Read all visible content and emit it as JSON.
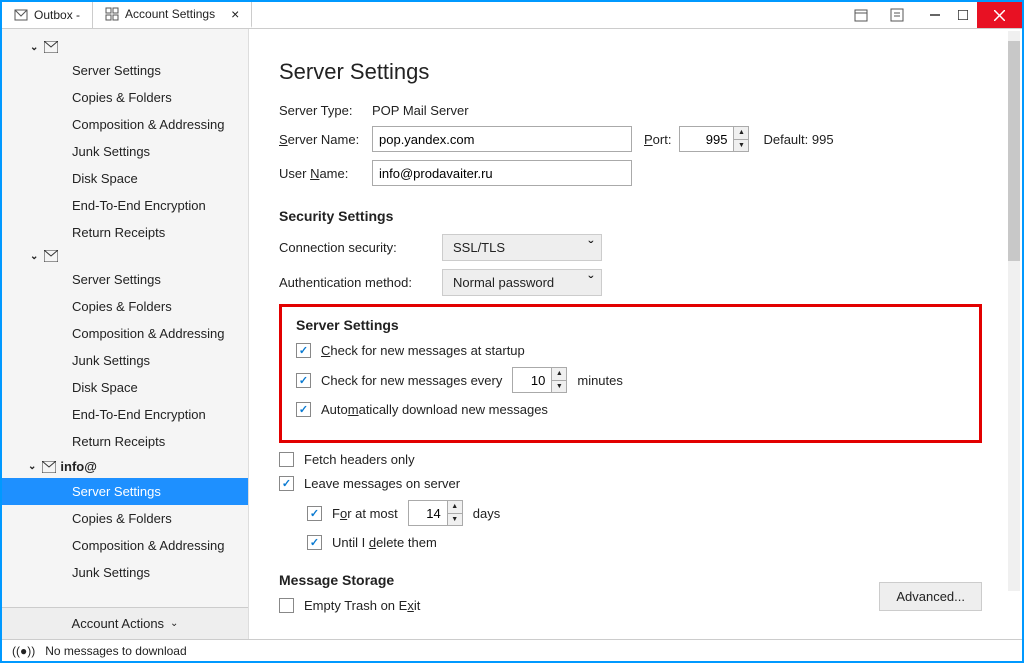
{
  "titlebar": {
    "tab_outbox": "Outbox -",
    "tab_settings": "Account Settings"
  },
  "sidebar": {
    "account1": {
      "items": [
        "Server Settings",
        "Copies & Folders",
        "Composition & Addressing",
        "Junk Settings",
        "Disk Space",
        "End-To-End Encryption",
        "Return Receipts"
      ]
    },
    "account2": {
      "items": [
        "Server Settings",
        "Copies & Folders",
        "Composition & Addressing",
        "Junk Settings",
        "Disk Space",
        "End-To-End Encryption",
        "Return Receipts"
      ]
    },
    "account3": {
      "label": "info@",
      "items": [
        "Server Settings",
        "Copies & Folders",
        "Composition & Addressing",
        "Junk Settings"
      ]
    },
    "account_actions": "Account Actions"
  },
  "page": {
    "title": "Server Settings",
    "server_type_label": "Server Type:",
    "server_type_value": "POP Mail Server",
    "server_name_label": "Server Name:",
    "server_name_value": "pop.yandex.com",
    "port_label": "Port:",
    "port_value": "995",
    "default_port": "Default: 995",
    "user_name_label": "User Name:",
    "user_name_value": "info@prodavaiter.ru",
    "security_heading": "Security Settings",
    "conn_sec_label": "Connection security:",
    "conn_sec_value": "SSL/TLS",
    "auth_label": "Authentication method:",
    "auth_value": "Normal password",
    "server_settings_heading": "Server Settings",
    "check_startup": "Check for new messages at startup",
    "check_every_pre": "Check for new messages every",
    "check_every_value": "10",
    "check_every_post": "minutes",
    "auto_download": "Automatically download new messages",
    "fetch_headers": "Fetch headers only",
    "leave_server": "Leave messages on server",
    "for_at_most_pre": "For at most",
    "for_at_most_value": "14",
    "for_at_most_post": "days",
    "until_delete": "Until I delete them",
    "message_storage_heading": "Message Storage",
    "empty_trash": "Empty Trash on Exit",
    "advanced_btn": "Advanced..."
  },
  "statusbar": {
    "message": "No messages to download"
  }
}
